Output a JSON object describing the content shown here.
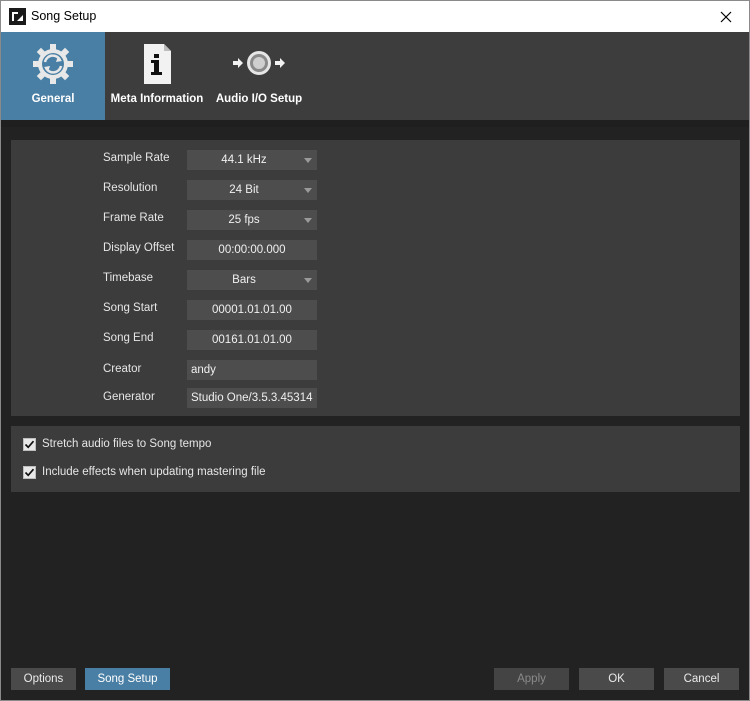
{
  "window": {
    "title": "Song Setup",
    "close_glyph": "✕"
  },
  "tabs": [
    {
      "label": "General",
      "icon": "gear-refresh-icon",
      "active": true
    },
    {
      "label": "Meta Information",
      "icon": "info-document-icon",
      "active": false
    },
    {
      "label": "Audio I/O Setup",
      "icon": "audio-io-icon",
      "active": false
    }
  ],
  "properties": {
    "sample_rate": {
      "label": "Sample Rate",
      "value": "44.1 kHz"
    },
    "resolution": {
      "label": "Resolution",
      "value": "24 Bit"
    },
    "frame_rate": {
      "label": "Frame Rate",
      "value": "25 fps"
    },
    "display_offset": {
      "label": "Display Offset",
      "value": "00:00:00.000"
    },
    "timebase": {
      "label": "Timebase",
      "value": "Bars"
    },
    "song_start": {
      "label": "Song Start",
      "value": "00001.01.01.00"
    },
    "song_end": {
      "label": "Song End",
      "value": "00161.01.01.00"
    },
    "creator": {
      "label": "Creator",
      "value": "andy"
    },
    "generator": {
      "label": "Generator",
      "value": "Studio One/3.5.3.45314"
    }
  },
  "options": [
    {
      "label": "Stretch audio files to Song tempo",
      "checked": true
    },
    {
      "label": "Include effects when updating mastering file",
      "checked": true
    }
  ],
  "buttons": {
    "options": "Options",
    "song_setup": "Song Setup",
    "apply": "Apply",
    "ok": "OK",
    "cancel": "Cancel"
  },
  "colors": {
    "accent": "#4a7fa5",
    "panel": "#3c3c3c",
    "background": "#222222"
  }
}
